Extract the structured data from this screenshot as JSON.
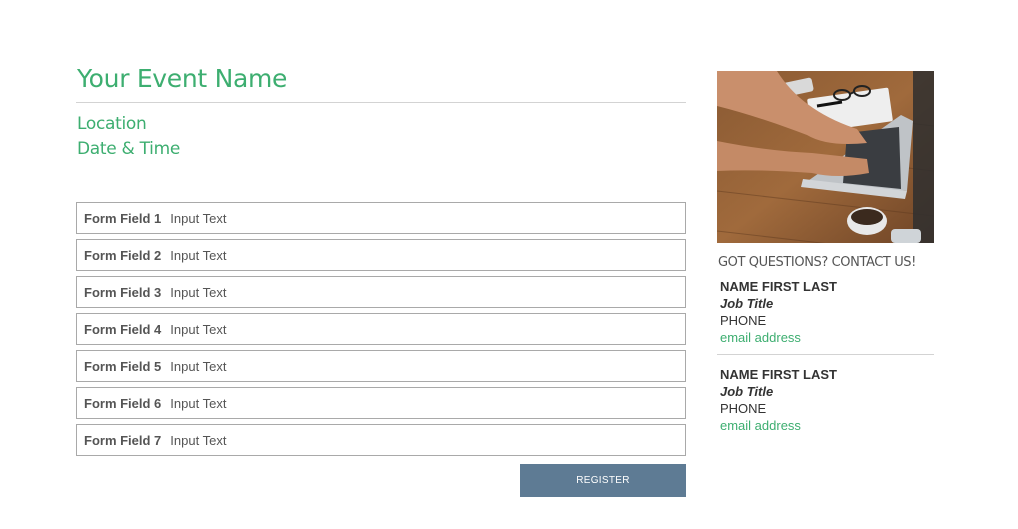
{
  "event": {
    "title": "Your Event Name",
    "location": "Location",
    "datetime": "Date & Time"
  },
  "form": {
    "fields": [
      {
        "label": "Form Field 1",
        "value": "Input Text"
      },
      {
        "label": "Form Field 2",
        "value": "Input Text"
      },
      {
        "label": "Form Field 3",
        "value": "Input Text"
      },
      {
        "label": "Form Field 4",
        "value": "Input Text"
      },
      {
        "label": "Form Field 5",
        "value": "Input Text"
      },
      {
        "label": "Form Field 6",
        "value": "Input Text"
      },
      {
        "label": "Form Field 7",
        "value": "Input Text"
      }
    ],
    "register_label": "REGISTER"
  },
  "sidebar": {
    "heading": "GOT QUESTIONS? CONTACT US!",
    "contacts": [
      {
        "name": "NAME FIRST LAST",
        "job_title": "Job Title",
        "phone": "PHONE",
        "email": "email address"
      },
      {
        "name": "NAME FIRST LAST",
        "job_title": "Job Title",
        "phone": "PHONE",
        "email": "email address"
      }
    ]
  },
  "colors": {
    "accent": "#3dae70",
    "button": "#5e7b94"
  }
}
